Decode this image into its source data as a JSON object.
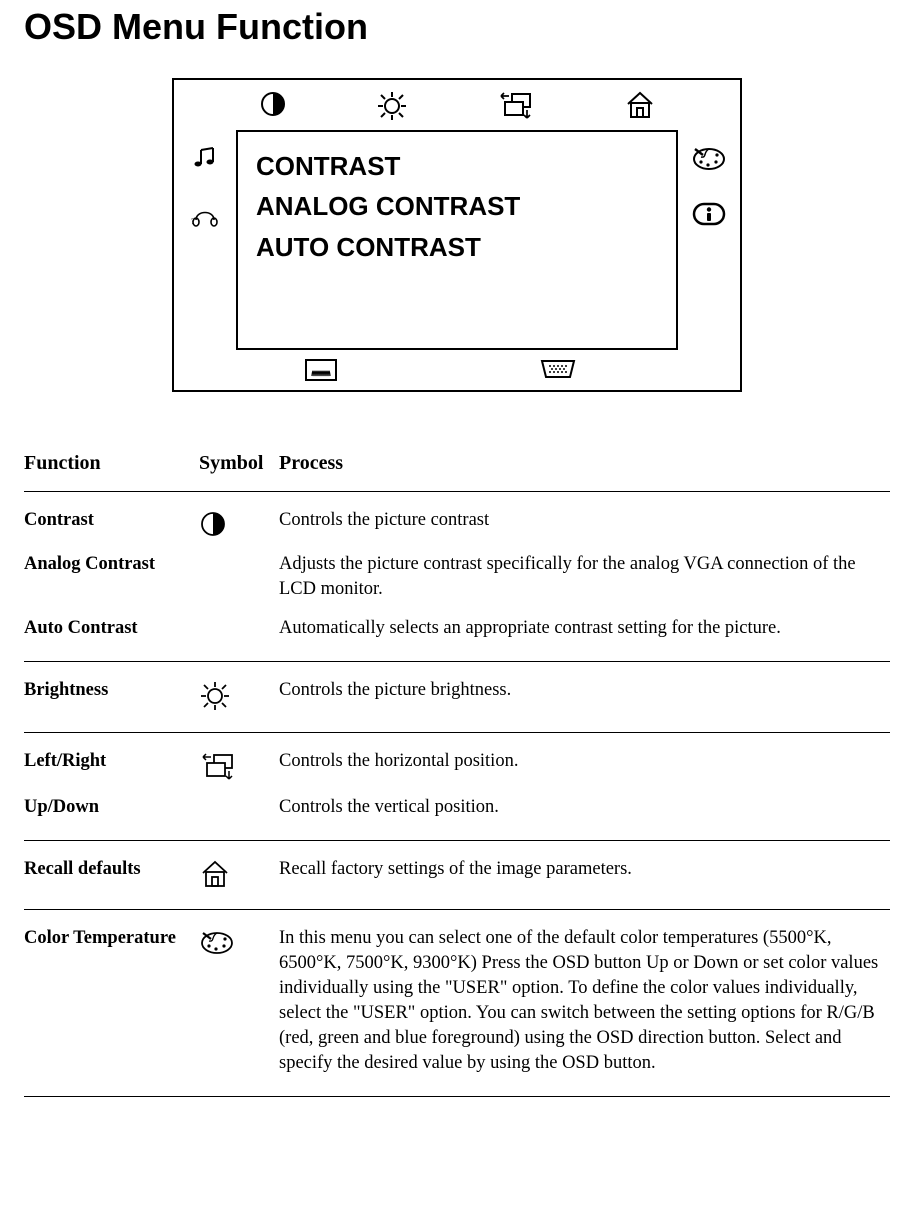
{
  "page_title": "OSD Menu Function",
  "osd_menu_lines": [
    "CONTRAST",
    "ANALOG CONTRAST",
    "AUTO CONTRAST"
  ],
  "headers": {
    "function": "Function",
    "symbol": "Symbol",
    "process": "Process"
  },
  "sections": [
    {
      "rows": [
        {
          "name": "Contrast",
          "process": "Controls the picture contrast"
        },
        {
          "name": "Analog Contrast",
          "process": "Adjusts the picture contrast specifically for the analog VGA connection of the LCD monitor."
        },
        {
          "name": "Auto Contrast",
          "process": "Automatically selects an appropriate contrast setting for the picture."
        }
      ]
    },
    {
      "rows": [
        {
          "name": "Brightness",
          "process": "Controls the picture brightness."
        }
      ]
    },
    {
      "rows": [
        {
          "name": "Left/Right",
          "process": "Controls the horizontal position."
        },
        {
          "name": "Up/Down",
          "process": "Controls the vertical position."
        }
      ]
    },
    {
      "rows": [
        {
          "name": "Recall defaults",
          "process": "Recall factory settings of the image parameters."
        }
      ]
    },
    {
      "rows": [
        {
          "name": "Color Temperature",
          "process": "In this menu you can select one of the default color temperatures (5500°K, 6500°K,  7500°K,  9300°K) Press the OSD button Up or Down or set color values individually using the \"USER\" option. To define the color values individually, select the \"USER\" option. You can switch between the setting options for R/G/B (red, green and blue foreground) using the OSD direction button. Select and specify the desired value by using the OSD button."
        }
      ]
    }
  ]
}
